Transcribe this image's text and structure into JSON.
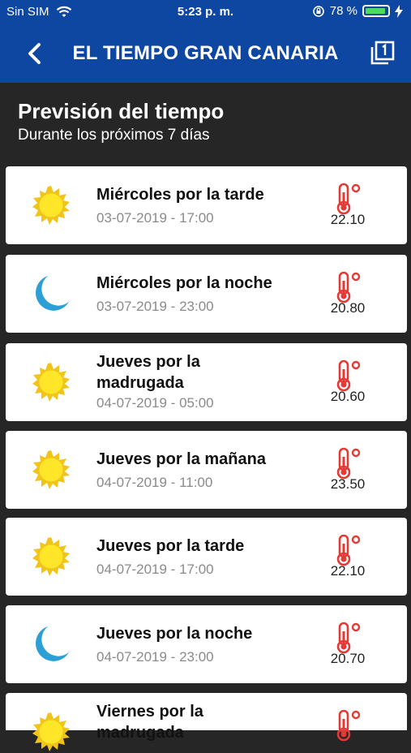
{
  "status": {
    "carrier": "Sin SIM",
    "time": "5:23 p. m.",
    "battery": "78 %"
  },
  "nav": {
    "title": "EL TIEMPO GRAN CANARIA"
  },
  "header": {
    "title": "Previsión del tiempo",
    "subtitle": "Durante los próximos 7 días"
  },
  "forecast": [
    {
      "title": "Miércoles por la tarde",
      "date": "03-07-2019 - 17:00",
      "temp": "22.10",
      "icon": "sun-icon"
    },
    {
      "title": "Miércoles por la noche",
      "date": "03-07-2019 - 23:00",
      "temp": "20.80",
      "icon": "moon-icon"
    },
    {
      "title": "Jueves por la madrugada",
      "date": "04-07-2019 - 05:00",
      "temp": "20.60",
      "icon": "sun-icon"
    },
    {
      "title": "Jueves por la mañana",
      "date": "04-07-2019 - 11:00",
      "temp": "23.50",
      "icon": "sun-icon"
    },
    {
      "title": "Jueves por la tarde",
      "date": "04-07-2019 - 17:00",
      "temp": "22.10",
      "icon": "sun-icon"
    },
    {
      "title": "Jueves por la noche",
      "date": "04-07-2019 - 23:00",
      "temp": "20.70",
      "icon": "moon-icon"
    },
    {
      "title": "Viernes por la madrugada",
      "date": "",
      "temp": "",
      "icon": "sun-icon"
    }
  ]
}
